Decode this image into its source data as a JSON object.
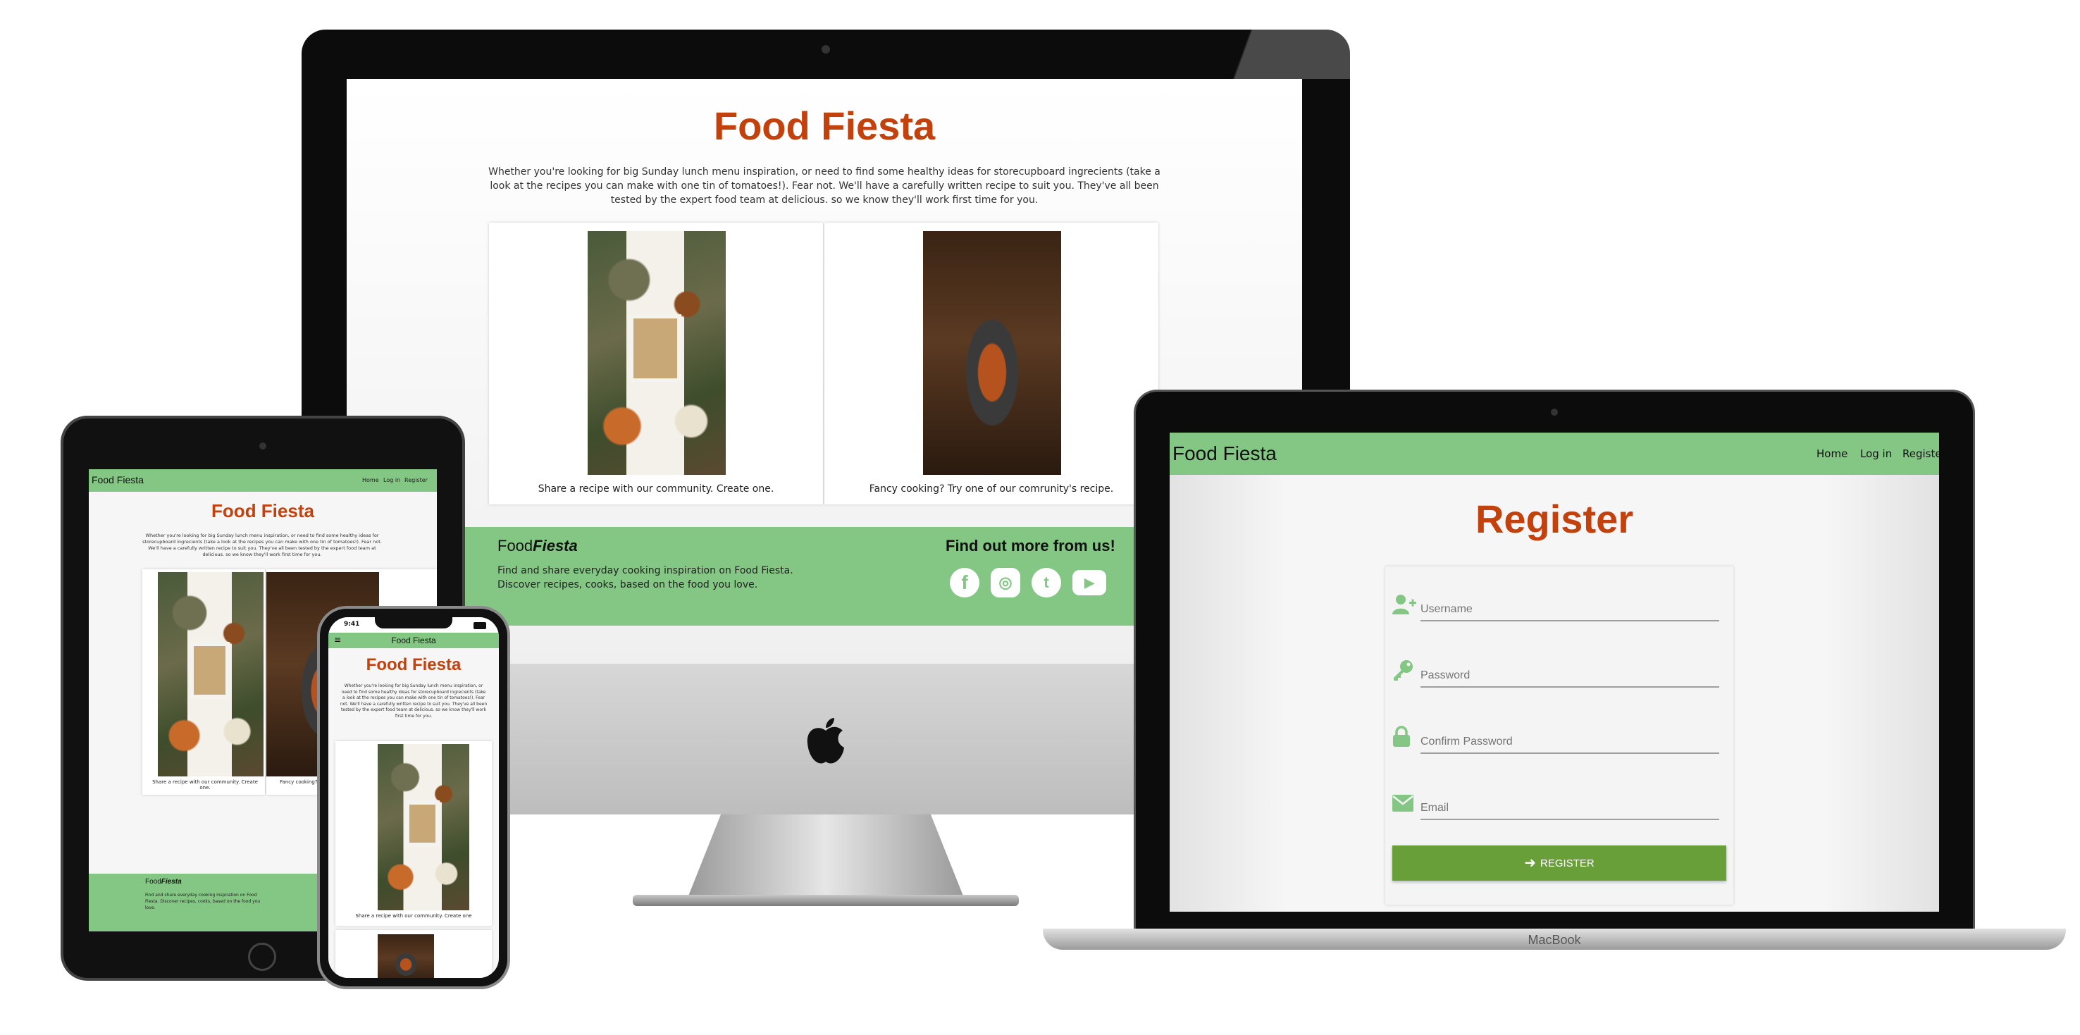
{
  "site": {
    "brand": "Food Fiesta",
    "brand_food": "Food",
    "brand_fiesta": "Fiesta",
    "home_title": "Food Fiesta",
    "intro": "Whether you're looking for big Sunday lunch menu inspiration, or need to find some healthy ideas for storecupboard ingrecients (take a look at the recipes you can make with one tin of tomatoes!). Fear not. We'll have a carefully written recipe to suit you. They've all been tested by the expert food team at delicious. so we know they'll work first time for you.",
    "card1_caption": "Share a recipe with our community. Create one.",
    "card2_caption": "Fancy cooking? Try one of our comrunity's recipe.",
    "tablet_card1_caption": "Share a recipe with our community. Create one.",
    "tablet_card2_caption": "Fancy cooking? Tr",
    "phone_card1_caption": "Share a recipe with our community. Create one",
    "footer_desc": "Find and share everyday cooking inspiration on Food Fiesta. Discover recipes, cooks, based on the food you love.",
    "footer_heading": "Find out more from us!",
    "social": [
      "facebook-icon",
      "instagram-icon",
      "twitter-icon",
      "youtube-icon"
    ],
    "nav": {
      "home": "Home",
      "login": "Log in",
      "register": "Register"
    }
  },
  "register": {
    "title": "Register",
    "username_placeholder": "Username",
    "password_placeholder": "Password",
    "confirm_placeholder": "Confirm Password",
    "email_placeholder": "Email",
    "button_label": "REGISTER"
  },
  "devices": {
    "laptop_label": "MacBook",
    "phone_time": "9:41"
  },
  "colors": {
    "accent_green": "#84c784",
    "button_green": "#689f38",
    "title_orange": "#c2410c"
  }
}
